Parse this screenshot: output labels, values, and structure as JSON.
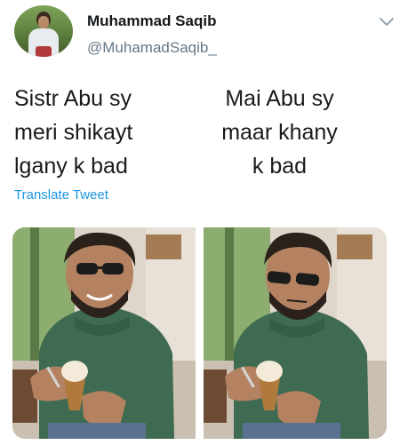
{
  "tweet": {
    "author_name": "Muhammad Saqib",
    "author_handle": "@MuhamadSaqib_",
    "text_left": "Sistr Abu sy\nmeri shikayt\nlgany k bad",
    "text_right": "Mai Abu sy\nmaar khany\nk bad",
    "translate_label": "Translate Tweet"
  },
  "colors": {
    "link": "#1b95e0",
    "handle": "#657786",
    "sweater": "#3e6b52"
  },
  "icons": {
    "menu": "chevron-down-icon"
  }
}
